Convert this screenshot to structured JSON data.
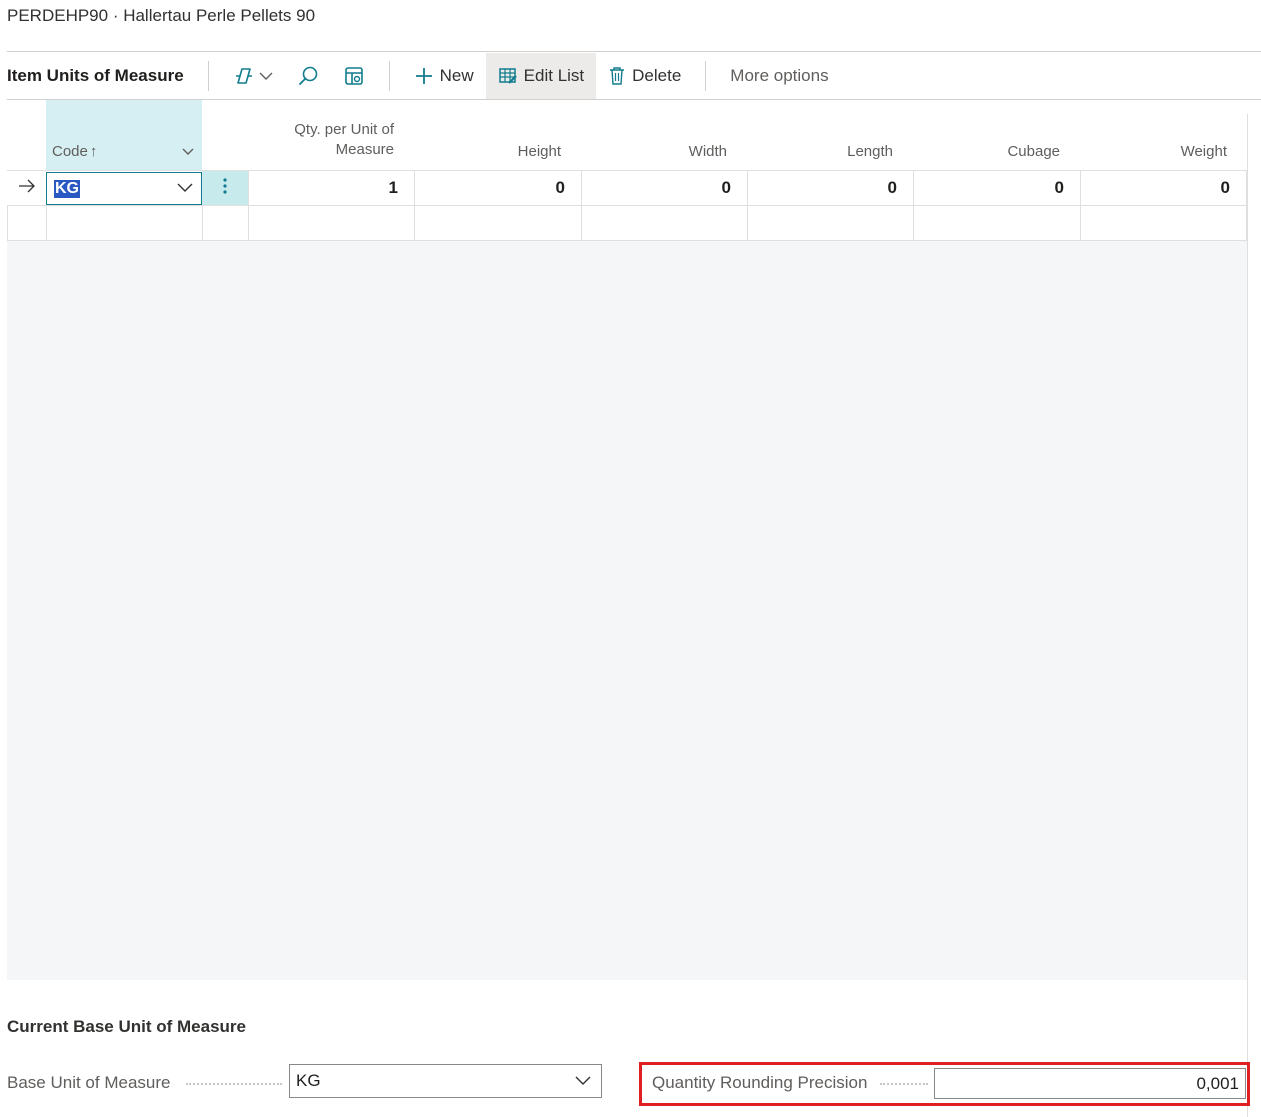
{
  "breadcrumb": "PERDEHP90 · Hallertau Perle Pellets 90",
  "toolbar": {
    "title": "Item Units of Measure",
    "new_label": "New",
    "edit_list_label": "Edit List",
    "delete_label": "Delete",
    "more_options_label": "More options"
  },
  "grid": {
    "columns": {
      "code": "Code",
      "sort_indicator": "↑",
      "qty_line1": "Qty. per Unit of",
      "qty_line2": "Measure",
      "height": "Height",
      "width": "Width",
      "length": "Length",
      "cubage": "Cubage",
      "weight": "Weight"
    },
    "rows": [
      {
        "code": "KG",
        "qty_per_unit": "1",
        "height": "0",
        "width": "0",
        "length": "0",
        "cubage": "0",
        "weight": "0"
      }
    ],
    "row_menu_icon": "vertical-ellipsis-icon",
    "row_indicator_icon": "arrow-right-icon"
  },
  "base_section": {
    "title": "Current Base Unit of Measure",
    "base_uom_label": "Base Unit of Measure",
    "base_uom_value": "KG",
    "rounding_label": "Quantity Rounding Precision",
    "rounding_value": "0,001"
  },
  "colors": {
    "highlight_border": "#e02020",
    "selected_column": "#d6eff2",
    "focus_border": "#107c8e",
    "text_selection": "#2b59c3"
  }
}
